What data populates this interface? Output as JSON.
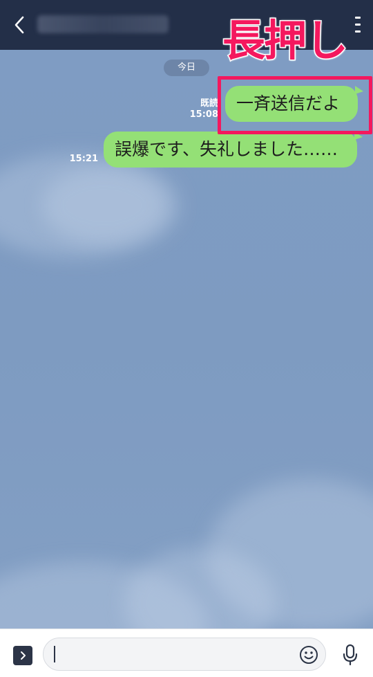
{
  "header": {
    "back_icon": "chevron-left-icon",
    "menu_icon": "hamburger-menu-icon"
  },
  "chat": {
    "date_label": "今日",
    "messages": [
      {
        "text": "一斉送信だよ",
        "read_status": "既読",
        "time": "15:08",
        "bubble_color": "#94e076"
      },
      {
        "text": "誤爆です、失礼しました……",
        "time": "15:21",
        "bubble_color": "#94e076"
      }
    ]
  },
  "annotation": {
    "label": "長押し",
    "color": "#f4185e"
  },
  "input_bar": {
    "value": "",
    "expand_icon": "chevron-right-icon",
    "emoji_icon": "smiley-icon",
    "mic_icon": "microphone-icon"
  },
  "colors": {
    "header_bg": "#232f48",
    "chat_bg": "#7f9cc2",
    "bubble": "#94e076",
    "highlight": "#f4185e"
  }
}
